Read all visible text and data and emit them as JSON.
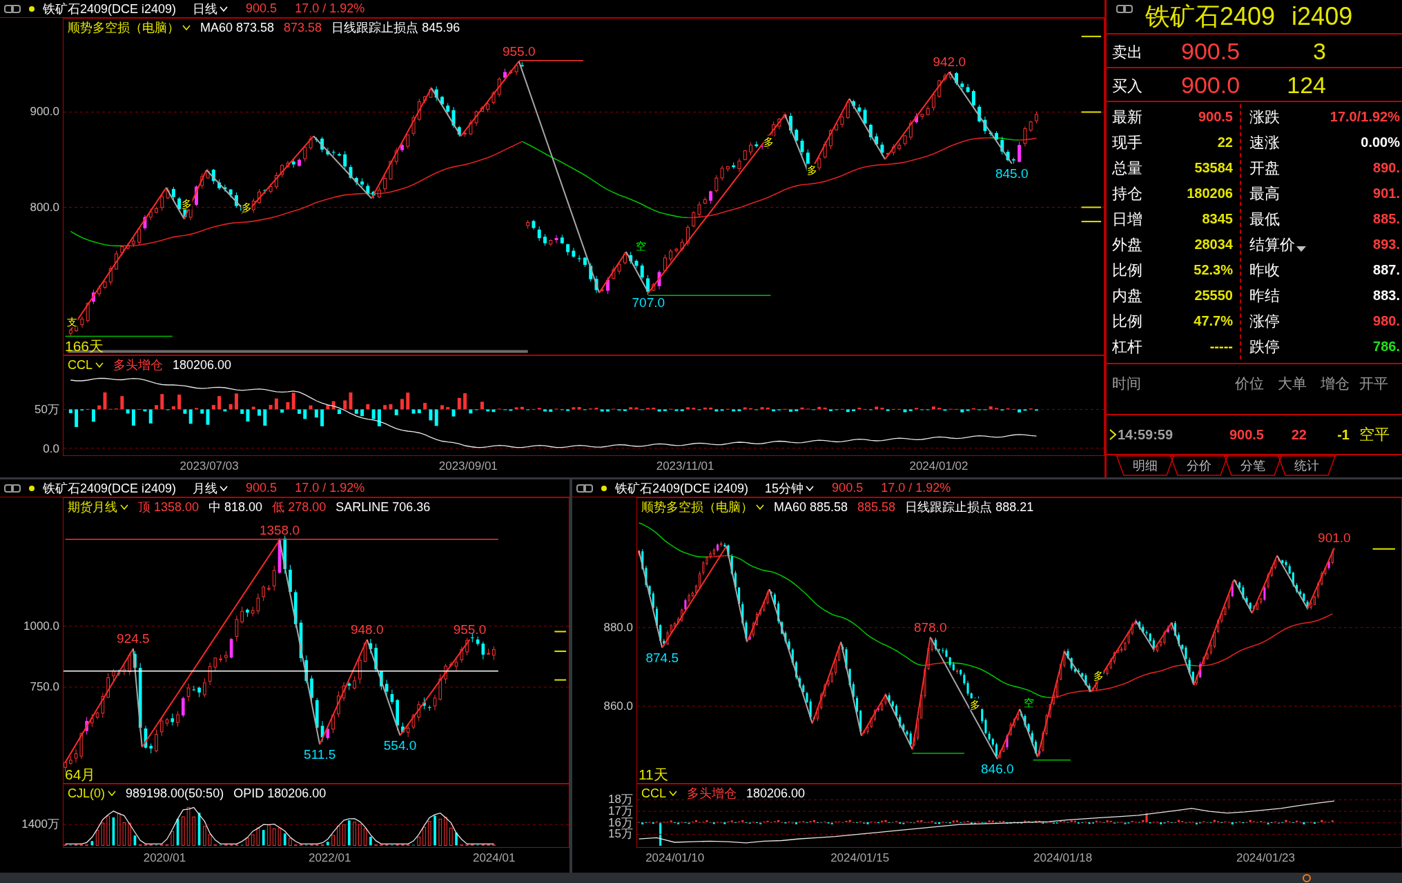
{
  "daily_chart": {
    "header": {
      "contract": "铁矿石2409(DCE i2409)",
      "period": "日线",
      "price": "900.5",
      "change": "17.0 / 1.92%"
    },
    "indicator": {
      "name": "顺势多空损（电脑）",
      "items": [
        {
          "text": "MA60 873.58",
          "color": "#ffffff"
        },
        {
          "text": "873.58",
          "color": "#ff3c3c"
        },
        {
          "text": "日线跟踪止损点 845.96",
          "color": "#ffffff"
        }
      ]
    },
    "price_ticks": [
      "900.0",
      "800.0"
    ],
    "labels": [
      {
        "text": "955.0",
        "kind": "high"
      },
      {
        "text": "942.0",
        "kind": "high"
      },
      {
        "text": "707.0",
        "kind": "low"
      },
      {
        "text": "845.0",
        "kind": "low"
      },
      {
        "text": "166天",
        "kind": "count"
      }
    ],
    "signals": [
      {
        "text": "支",
        "kind": "long"
      },
      {
        "text": "多",
        "kind": "long"
      },
      {
        "text": "多",
        "kind": "long"
      },
      {
        "text": "空",
        "kind": "short"
      },
      {
        "text": "多",
        "kind": "long"
      },
      {
        "text": "多",
        "kind": "long"
      }
    ],
    "sub_indicator": {
      "name": "CCL",
      "items": [
        {
          "text": "多头增仓",
          "color": "#ff3c3c"
        },
        {
          "text": "180206.00",
          "color": "#ffffff"
        }
      ]
    },
    "sub_ticks": [
      "50万",
      "0.0"
    ],
    "dates": [
      "2023/07/03",
      "2023/09/01",
      "2023/11/01",
      "2024/01/02"
    ]
  },
  "quote_panel": {
    "title": "铁矿石2409",
    "code": "i2409",
    "ask": {
      "label": "卖出",
      "price": "900.5",
      "volume": "3"
    },
    "bid": {
      "label": "买入",
      "price": "900.0",
      "volume": "124"
    },
    "left": [
      {
        "label": "最新",
        "value": "900.5",
        "color": "#ff3c3c"
      },
      {
        "label": "现手",
        "value": "22",
        "color": "#e6e600"
      },
      {
        "label": "总量",
        "value": "53584",
        "color": "#e6e600"
      },
      {
        "label": "持仓",
        "value": "180206",
        "color": "#e6e600"
      },
      {
        "label": "日增",
        "value": "8345",
        "color": "#e6e600"
      },
      {
        "label": "外盘",
        "value": "28034",
        "color": "#e6e600"
      },
      {
        "label": "比例",
        "value": "52.3%",
        "color": "#e6e600"
      },
      {
        "label": "内盘",
        "value": "25550",
        "color": "#e6e600"
      },
      {
        "label": "比例",
        "value": "47.7%",
        "color": "#e6e600"
      },
      {
        "label": "杠杆",
        "value": "-----",
        "color": "#e6e600"
      }
    ],
    "right": [
      {
        "label": "涨跌",
        "value": "17.0/1.92%",
        "color": "#ff3c3c",
        "dropdown": false
      },
      {
        "label": "速涨",
        "value": "0.00%",
        "color": "#ffffff",
        "dropdown": false
      },
      {
        "label": "开盘",
        "value": "890.",
        "color": "#ff3c3c",
        "dropdown": false
      },
      {
        "label": "最高",
        "value": "901.",
        "color": "#ff3c3c",
        "dropdown": false
      },
      {
        "label": "最低",
        "value": "885.",
        "color": "#ff3c3c",
        "dropdown": false
      },
      {
        "label": "结算价",
        "value": "893.",
        "color": "#ff3c3c",
        "dropdown": true
      },
      {
        "label": "昨收",
        "value": "887.",
        "color": "#ffffff",
        "dropdown": false
      },
      {
        "label": "昨结",
        "value": "883.",
        "color": "#ffffff",
        "dropdown": false
      },
      {
        "label": "涨停",
        "value": "980.",
        "color": "#ff3c3c",
        "dropdown": false
      },
      {
        "label": "跌停",
        "value": "786.",
        "color": "#20e020",
        "dropdown": false
      }
    ],
    "columns": [
      "时间",
      "价位",
      "大单",
      "增仓",
      "开平"
    ],
    "ticks": [
      {
        "time": "14:59:59",
        "price": "900.5",
        "volume": "22",
        "change": "-1",
        "type": "空平",
        "selected": true
      }
    ],
    "tabs": [
      {
        "label": "明细",
        "selected": false
      },
      {
        "label": "分价",
        "selected": false
      },
      {
        "label": "分笔",
        "selected": false
      },
      {
        "label": "统计",
        "selected": false
      }
    ]
  },
  "monthly_chart": {
    "header": {
      "contract": "铁矿石2409(DCE i2409)",
      "period": "月线",
      "price": "900.5",
      "change": "17.0 / 1.92%"
    },
    "indicator": {
      "name": "期货月线",
      "items": [
        {
          "text": "顶 1358.00",
          "color": "#ff3c3c"
        },
        {
          "text": "中 818.00",
          "color": "#ffffff"
        },
        {
          "text": "低 278.00",
          "color": "#ff3c3c"
        },
        {
          "text": "SARLINE 706.36",
          "color": "#ffffff"
        }
      ]
    },
    "price_ticks": [
      "1000.0",
      "750.0"
    ],
    "labels": [
      {
        "text": "1358.0",
        "kind": "high"
      },
      {
        "text": "924.5",
        "kind": "high"
      },
      {
        "text": "948.0",
        "kind": "high"
      },
      {
        "text": "955.0",
        "kind": "high"
      },
      {
        "text": "511.5",
        "kind": "low"
      },
      {
        "text": "554.0",
        "kind": "low"
      },
      {
        "text": "64月",
        "kind": "count"
      }
    ],
    "sub_indicator": {
      "name": "CJL(0)",
      "items": [
        {
          "text": "989198.00(50:50)",
          "color": "#ffffff"
        },
        {
          "text": "OPID 180206.00",
          "color": "#ffffff"
        }
      ]
    },
    "sub_ticks": [
      "1400万"
    ],
    "dates": [
      "2020/01",
      "2022/01",
      "2024/01"
    ]
  },
  "minute_chart": {
    "header": {
      "contract": "铁矿石2409(DCE i2409)",
      "period": "15分钟",
      "price": "900.5",
      "change": "17.0 / 1.92%"
    },
    "indicator": {
      "name": "顺势多空损（电脑）",
      "items": [
        {
          "text": "MA60 885.58",
          "color": "#ffffff"
        },
        {
          "text": "885.58",
          "color": "#ff3c3c"
        },
        {
          "text": "日线跟踪止损点 888.21",
          "color": "#ffffff"
        }
      ]
    },
    "price_ticks": [
      "880.0",
      "860.0"
    ],
    "labels": [
      {
        "text": "901.0",
        "kind": "high"
      },
      {
        "text": "878.0",
        "kind": "high"
      },
      {
        "text": "874.5",
        "kind": "low"
      },
      {
        "text": "846.0",
        "kind": "low"
      },
      {
        "text": "11天",
        "kind": "count"
      }
    ],
    "signals": [
      {
        "text": "多",
        "kind": "long"
      },
      {
        "text": "空",
        "kind": "short"
      },
      {
        "text": "多",
        "kind": "long"
      }
    ],
    "sub_indicator": {
      "items": [
        {
          "text": "多头增仓",
          "color": "#ff3c3c"
        },
        {
          "text": "180206.00",
          "color": "#ffffff"
        }
      ]
    },
    "chart_data": {
      "type": "line",
      "grid": true,
      "ylim": [
        13.88,
        19.35
      ],
      "yticks": [
        {
          "value": 18,
          "label": "18万"
        },
        {
          "value": 17,
          "label": "17万"
        },
        {
          "value": 16,
          "label": "16万"
        },
        {
          "value": 15,
          "label": "15万"
        }
      ],
      "series": [
        {
          "name": "CCL",
          "color": "#e8e8e8",
          "values": [
            14.59,
            14.7,
            14.3,
            14.35,
            14.4,
            14.35,
            14.25,
            14.4,
            14.45,
            14.6,
            14.7,
            14.8,
            14.95,
            15.1,
            15.25,
            15.4,
            15.55,
            15.7,
            15.85,
            15.9,
            15.95,
            16.0,
            16.05,
            16.1,
            16.25,
            16.35,
            16.45,
            16.55,
            16.65,
            16.85,
            17.05,
            17.25,
            17.0,
            16.85,
            16.95,
            17.1,
            17.25,
            17.5,
            17.7,
            17.9
          ]
        }
      ]
    },
    "dates": [
      "2024/01/10",
      "2024/01/15",
      "2024/01/18",
      "2024/01/23"
    ]
  }
}
